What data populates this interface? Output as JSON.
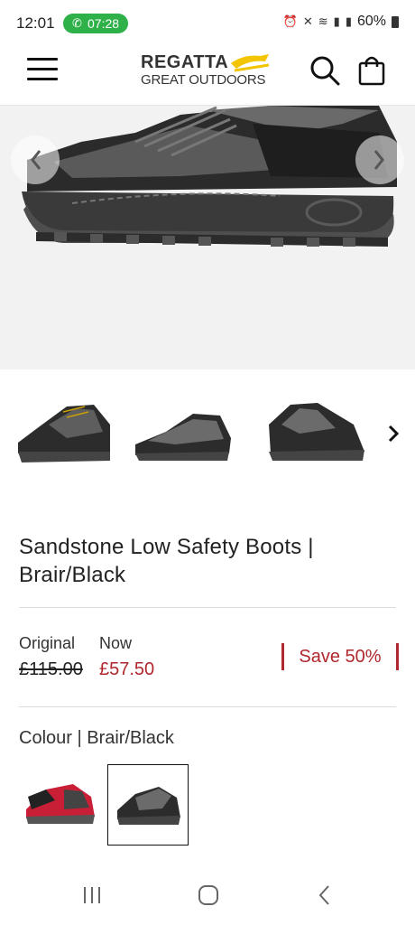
{
  "status_bar": {
    "time": "12:01",
    "call_timer": "07:28",
    "battery": "60%"
  },
  "header": {
    "brand_line1": "REGATTA",
    "brand_line2": "GREAT OUTDOORS",
    "brand_color": "#f2c500"
  },
  "product": {
    "title": "Sandstone Low Safety Boots | Brair/Black",
    "original_label": "Original",
    "original_price": "£115.00",
    "now_label": "Now",
    "now_price": "£57.50",
    "save_text": "Save 50%",
    "colour_label": "Colour | Brair/Black",
    "accent_color": "#b0272d"
  },
  "gallery": {
    "thumbnails": [
      "side-view",
      "angled-view",
      "front-angled-view"
    ]
  },
  "colour_swatches": [
    {
      "name": "red-black",
      "selected": false
    },
    {
      "name": "brair-black",
      "selected": true
    }
  ]
}
